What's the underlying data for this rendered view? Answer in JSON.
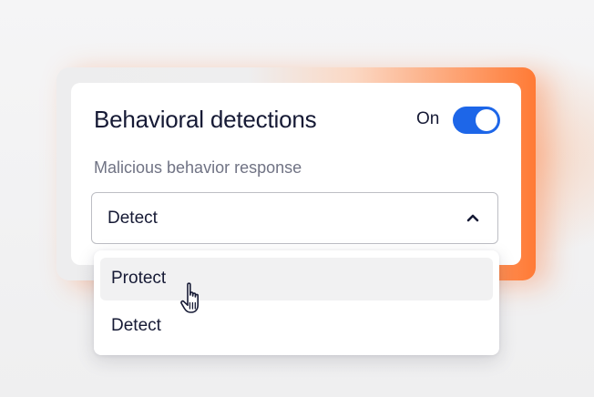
{
  "card": {
    "title": "Behavioral detections",
    "toggle": {
      "label": "On",
      "state": "on",
      "color": "#1d66e8"
    },
    "subtitle": "Malicious behavior response"
  },
  "select": {
    "value": "Detect",
    "icon": "chevron-up-icon",
    "expanded": true
  },
  "menu": {
    "items": [
      {
        "label": "Protect",
        "hovered": true
      },
      {
        "label": "Detect",
        "hovered": false
      }
    ]
  },
  "cursor": {
    "icon": "hand-pointer-icon"
  },
  "colors": {
    "accent_glow": "#ff7a35",
    "text_primary": "#161a35",
    "text_secondary": "#707384"
  }
}
